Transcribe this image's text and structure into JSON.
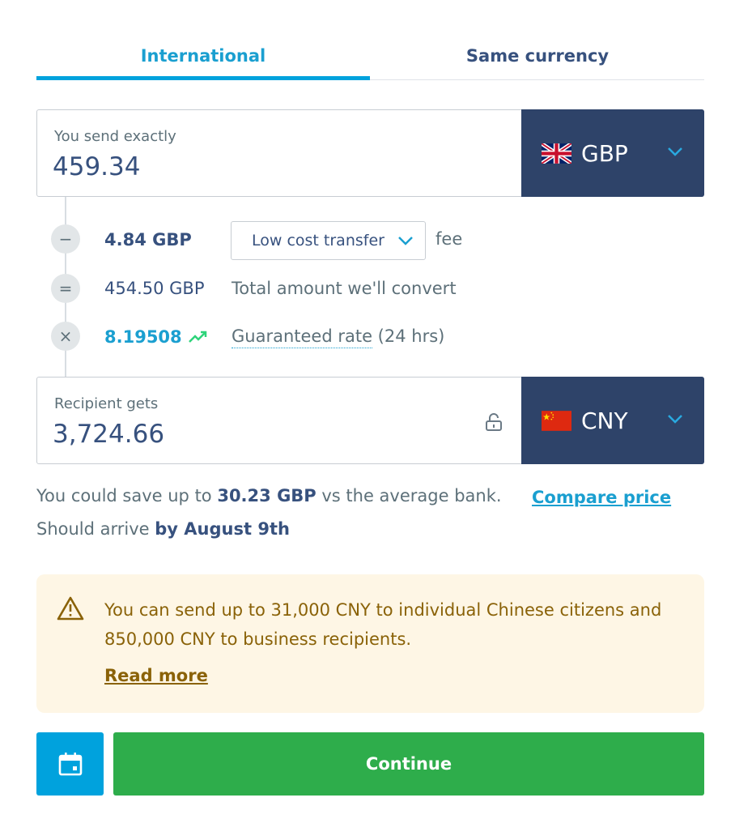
{
  "tabs": [
    {
      "label": "International",
      "active": true
    },
    {
      "label": "Same currency",
      "active": false
    }
  ],
  "send": {
    "label": "You send exactly",
    "amount": "459.34",
    "currency": "GBP",
    "flag_icon": "uk-flag-icon"
  },
  "breakdown": {
    "fee": {
      "operator": "−",
      "amount": "4.84 GBP",
      "method": "Low cost transfer",
      "suffix": "fee"
    },
    "total": {
      "operator": "=",
      "amount": "454.50 GBP",
      "desc": "Total amount we'll convert"
    },
    "rate": {
      "operator": "×",
      "amount": "8.19508",
      "desc_link": "Guaranteed rate",
      "desc_suffix": " (24 hrs)",
      "trend_icon": "trend-up-icon"
    }
  },
  "receive": {
    "label": "Recipient gets",
    "amount": "3,724.66",
    "currency": "CNY",
    "flag_icon": "china-flag-icon"
  },
  "savings": {
    "prefix": "You could save up to ",
    "amount": "30.23 GBP",
    "suffix": " vs the average bank.",
    "compare_link": "Compare price"
  },
  "arrival": {
    "prefix": "Should arrive ",
    "date": "by August 9th"
  },
  "warning": {
    "text": "You can send up to 31,000 CNY to individual Chinese citizens and 850,000 CNY to business recipients.",
    "link": "Read more"
  },
  "actions": {
    "continue_label": "Continue"
  },
  "colors": {
    "accent": "#00a2dd",
    "navy": "#2e4369",
    "green": "#2ead4b",
    "warning_bg": "#fef6e5",
    "warning_text": "#8a6208"
  }
}
